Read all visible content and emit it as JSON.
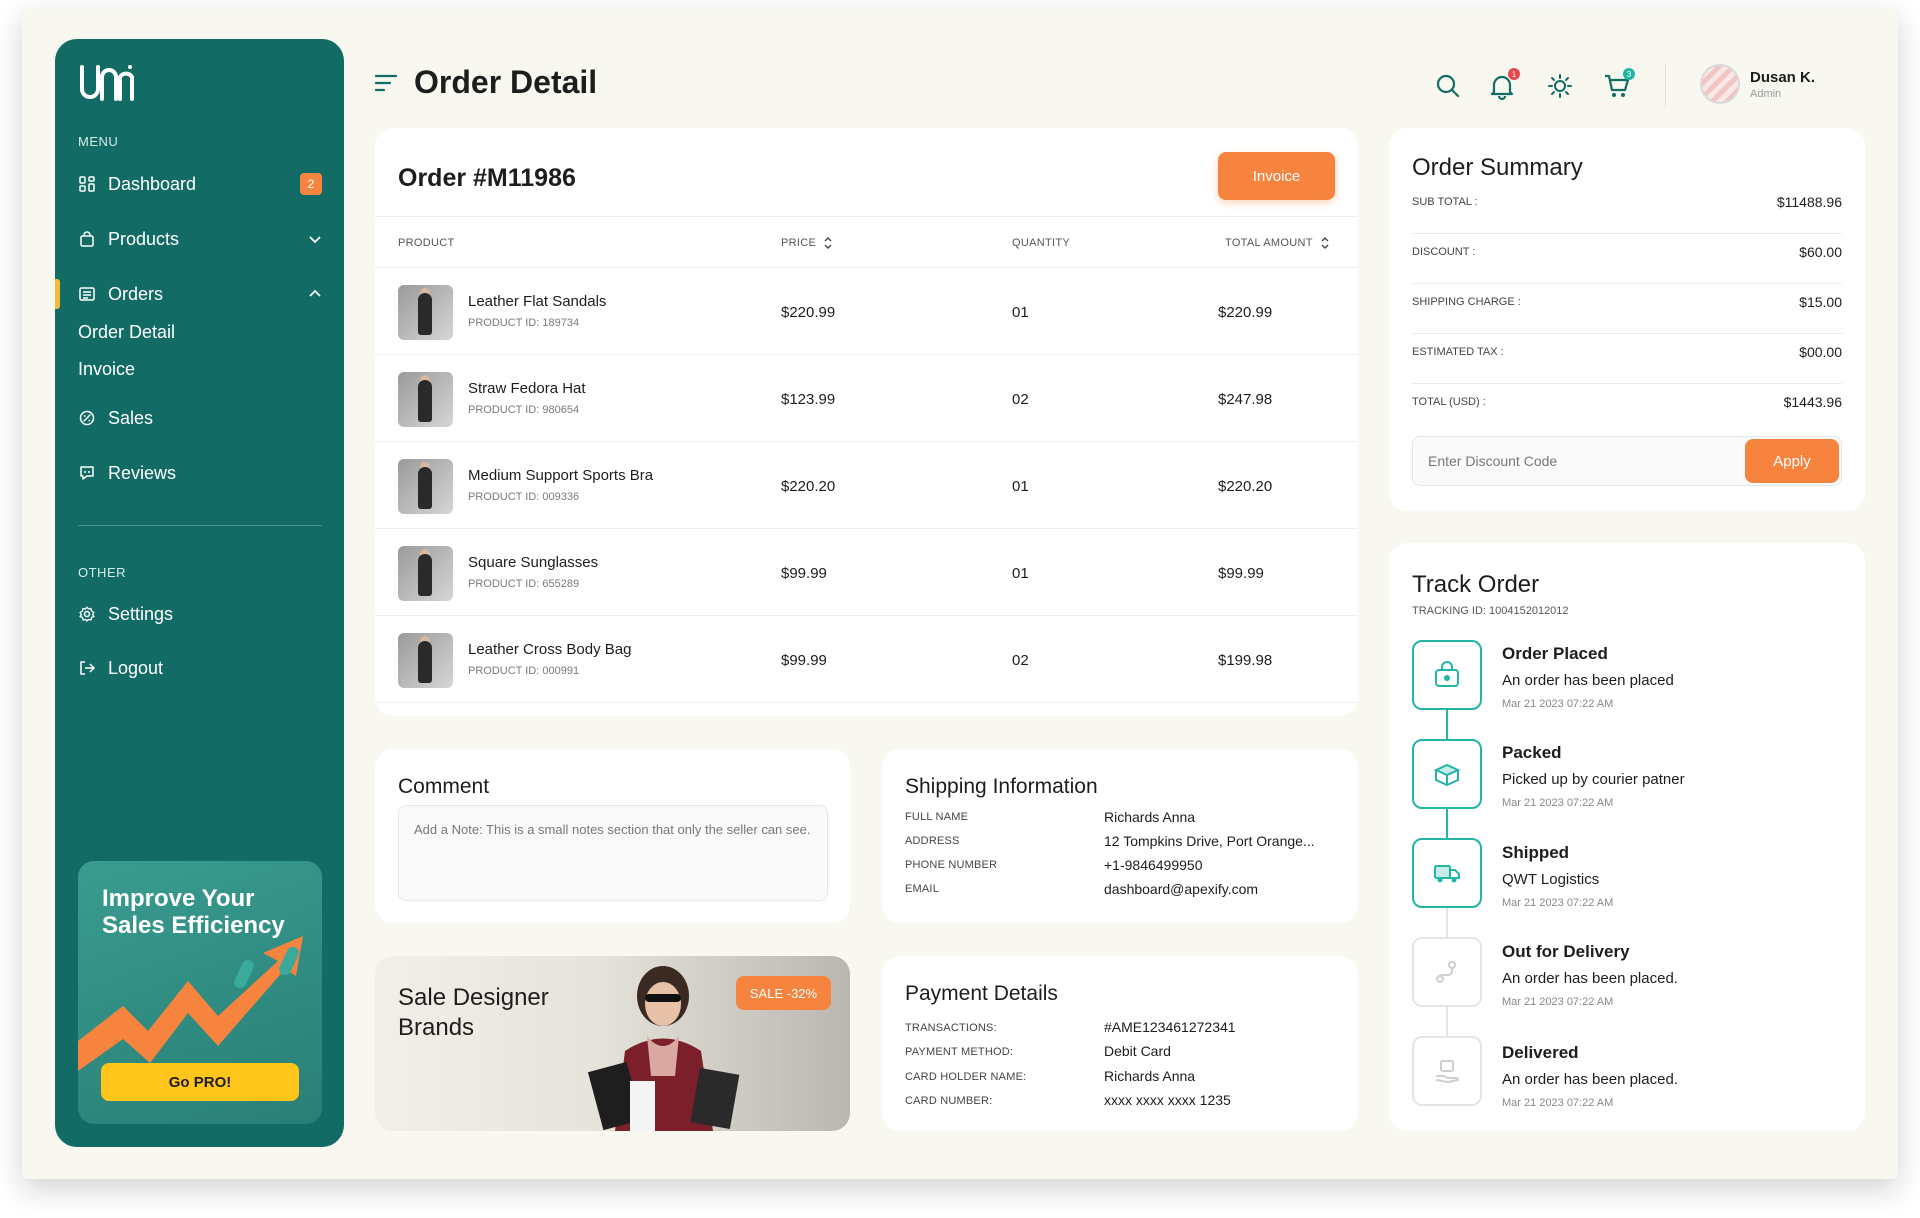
{
  "brand": {
    "logo_text": "ᘮᘮᘮ",
    "accent": "#126c65",
    "orange": "#f6843f",
    "teal": "#22b5a5"
  },
  "sidebar": {
    "menu_label": "MENU",
    "items": [
      {
        "label": "Dashboard",
        "icon": "dashboard-icon",
        "badge": "2"
      },
      {
        "label": "Products",
        "icon": "bag-icon"
      },
      {
        "label": "Orders",
        "icon": "orders-icon"
      },
      {
        "label": "Sales",
        "icon": "sales-icon"
      },
      {
        "label": "Reviews",
        "icon": "reviews-icon"
      }
    ],
    "sub_items": [
      "Order Detail",
      "Invoice"
    ],
    "other_label": "OTHER",
    "other_items": [
      {
        "label": "Settings",
        "icon": "gear-icon"
      },
      {
        "label": "Logout",
        "icon": "logout-icon"
      }
    ],
    "promo": {
      "title": "Improve Your Sales Efficiency",
      "button": "Go PRO!"
    }
  },
  "header": {
    "title": "Order Detail",
    "notification_count": "1",
    "cart_count": "3",
    "user": {
      "name": "Dusan K.",
      "role": "Admin"
    }
  },
  "order": {
    "title": "Order #M11986",
    "invoice_button": "Invoice",
    "columns": [
      "PRODUCT",
      "PRICE",
      "QUANTITY",
      "TOTAL AMOUNT"
    ],
    "rows": [
      {
        "name": "Leather Flat Sandals",
        "id": "PRODUCT ID: 189734",
        "price": "$220.99",
        "qty": "01",
        "total": "$220.99"
      },
      {
        "name": "Straw Fedora Hat",
        "id": "PRODUCT ID: 980654",
        "price": "$123.99",
        "qty": "02",
        "total": "$247.98"
      },
      {
        "name": "Medium Support Sports Bra",
        "id": "PRODUCT ID: 009336",
        "price": "$220.20",
        "qty": "01",
        "total": "$220.20"
      },
      {
        "name": "Square Sunglasses",
        "id": "PRODUCT ID: 655289",
        "price": "$99.99",
        "qty": "01",
        "total": "$99.99"
      },
      {
        "name": "Leather Cross Body Bag",
        "id": "PRODUCT ID: 000991",
        "price": "$99.99",
        "qty": "02",
        "total": "$199.98"
      }
    ]
  },
  "comment": {
    "title": "Comment",
    "placeholder": "Add a Note:  This is a small notes section that only the seller can see."
  },
  "shipping": {
    "title": "Shipping Information",
    "fields": [
      {
        "label": "FULL NAME",
        "value": "Richards Anna"
      },
      {
        "label": "ADDRESS",
        "value": "12 Tompkins Drive, Port Orange..."
      },
      {
        "label": "PHONE NUMBER",
        "value": "+1-9846499950"
      },
      {
        "label": "EMAIL",
        "value": "dashboard@apexify.com"
      }
    ]
  },
  "sale": {
    "title": "Sale Designer Brands",
    "badge": "SALE -32%"
  },
  "payment": {
    "title": "Payment Details",
    "fields": [
      {
        "label": "TRANSACTIONS:",
        "value": "#AME123461272341"
      },
      {
        "label": "PAYMENT METHOD:",
        "value": "Debit Card"
      },
      {
        "label": "CARD HOLDER NAME:",
        "value": "Richards Anna"
      },
      {
        "label": "CARD NUMBER:",
        "value": "xxxx xxxx xxxx 1235"
      }
    ]
  },
  "summary": {
    "title": "Order Summary",
    "rows": [
      {
        "label": "SUB TOTAL :",
        "value": "$11488.96"
      },
      {
        "label": "DISCOUNT :",
        "value": "$60.00"
      },
      {
        "label": "SHIPPING CHARGE :",
        "value": "$15.00"
      },
      {
        "label": "ESTIMATED TAX :",
        "value": "$00.00"
      },
      {
        "label": "TOTAL (USD) :",
        "value": "$1443.96"
      }
    ],
    "discount_placeholder": "Enter Discount Code",
    "apply_button": "Apply"
  },
  "track": {
    "title": "Track Order",
    "tracking_id": "TRACKING ID: 1004152012012",
    "steps": [
      {
        "status": "Order Placed",
        "desc": "An order has been placed",
        "time": "Mar 21 2023 07:22 AM",
        "icon": "shopping-bag-icon",
        "done": true
      },
      {
        "status": "Packed",
        "desc": "Picked up by courier patner",
        "time": "Mar 21 2023 07:22 AM",
        "icon": "package-icon",
        "done": true
      },
      {
        "status": "Shipped",
        "desc": "QWT Logistics",
        "time": "Mar 21 2023 07:22 AM",
        "icon": "truck-icon",
        "done": true
      },
      {
        "status": "Out for Delivery",
        "desc": "An order has been placed.",
        "time": "Mar 21 2023 07:22 AM",
        "icon": "route-icon",
        "done": false
      },
      {
        "status": "Delivered",
        "desc": "An order has been placed.",
        "time": "Mar 21 2023 07:22 AM",
        "icon": "delivered-icon",
        "done": false
      }
    ]
  }
}
